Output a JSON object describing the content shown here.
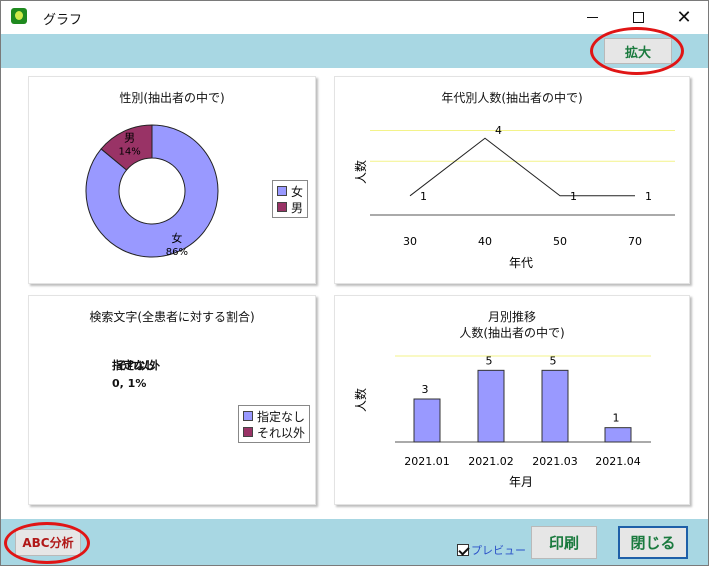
{
  "window": {
    "title": "グラフ"
  },
  "toolbar": {
    "zoom_label": "拡大"
  },
  "panel_gender": {
    "title": "性別(抽出者の中で)",
    "slices": [
      {
        "label": "女",
        "percent_text": "86%",
        "value": 86,
        "color": "#9999ff"
      },
      {
        "label": "男",
        "percent_text": "14%",
        "value": 14,
        "color": "#993366"
      }
    ],
    "legend": [
      "女",
      "男"
    ]
  },
  "panel_age": {
    "title": "年代別人数(抽出者の中で)",
    "ylabel": "人数",
    "xlabel": "年代",
    "categories": [
      "30",
      "40",
      "50",
      "70"
    ],
    "values": [
      1,
      4,
      1,
      1
    ],
    "value_labels": [
      "1",
      "4",
      "1",
      "1"
    ]
  },
  "panel_search": {
    "title": "検索文字(全患者に対する割合)",
    "overlap_line1": "指定なし",
    "overlap_line2": "それ以外",
    "value_text": "0, 1%",
    "legend": [
      "指定なし",
      "それ以外"
    ]
  },
  "panel_monthly": {
    "title": "月別推移",
    "subtitle": "人数(抽出者の中で)",
    "ylabel": "人数",
    "xlabel": "年月",
    "categories": [
      "2021.01",
      "2021.02",
      "2021.03",
      "2021.04"
    ],
    "values": [
      3,
      5,
      5,
      1
    ],
    "value_labels": [
      "3",
      "5",
      "5",
      "1"
    ]
  },
  "footer": {
    "abc_label": "ABC分析",
    "preview_label": "プレビュー",
    "print_label": "印刷",
    "close_label": "閉じる"
  },
  "chart_data": [
    {
      "type": "pie",
      "title": "性別(抽出者の中で)",
      "categories": [
        "女",
        "男"
      ],
      "values": [
        86,
        14
      ],
      "unit": "%"
    },
    {
      "type": "line",
      "title": "年代別人数(抽出者の中で)",
      "xlabel": "年代",
      "ylabel": "人数",
      "categories": [
        "30",
        "40",
        "50",
        "70"
      ],
      "values": [
        1,
        4,
        1,
        1
      ]
    },
    {
      "type": "bar",
      "title": "月別推移 人数(抽出者の中で)",
      "xlabel": "年月",
      "ylabel": "人数",
      "categories": [
        "2021.01",
        "2021.02",
        "2021.03",
        "2021.04"
      ],
      "values": [
        3,
        5,
        5,
        1
      ]
    }
  ]
}
